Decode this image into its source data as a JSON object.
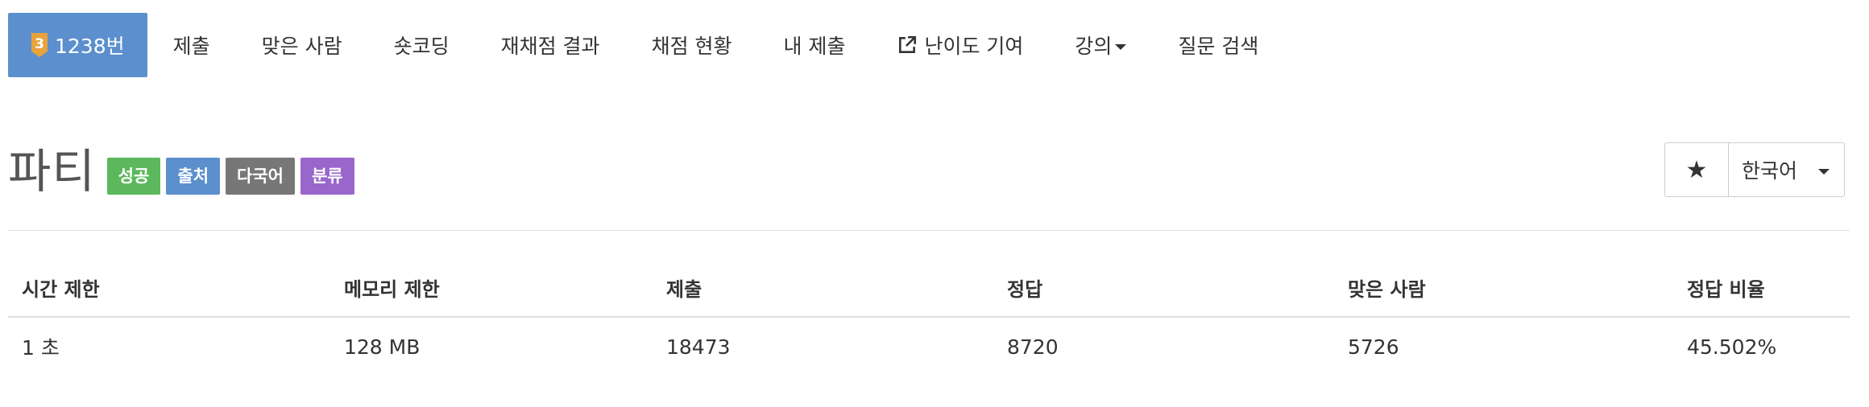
{
  "nav": {
    "problem_number": "1238번",
    "tier_badge": "3",
    "tier_color": "#e8a33d",
    "accent": "#5b8fcd",
    "tabs": {
      "submit": "제출",
      "solved_users": "맞은 사람",
      "short_coding": "숏코딩",
      "rejudge_result": "재채점 결과",
      "judge_status": "채점 현황",
      "my_submissions": "내 제출",
      "difficulty_contribute": "난이도 기여",
      "lecture": "강의",
      "question_search": "질문 검색"
    },
    "icons": {
      "external": "external-link-icon",
      "dropdown": "caret-down-icon"
    }
  },
  "problem": {
    "title": "파티",
    "labels": {
      "success": "성공",
      "source": "출처",
      "multilingual": "다국어",
      "classification": "분류"
    },
    "label_colors": {
      "success": "#5cb85c",
      "source": "#5b8fcd",
      "multilingual": "#777777",
      "classification": "#9966cc"
    }
  },
  "actions": {
    "favorite_icon": "star-icon",
    "favorite_glyph": "★",
    "language": "한국어"
  },
  "info_table": {
    "headers": [
      "시간 제한",
      "메모리 제한",
      "제출",
      "정답",
      "맞은 사람",
      "정답 비율"
    ],
    "row": [
      "1 초",
      "128 MB",
      "18473",
      "8720",
      "5726",
      "45.502%"
    ]
  }
}
